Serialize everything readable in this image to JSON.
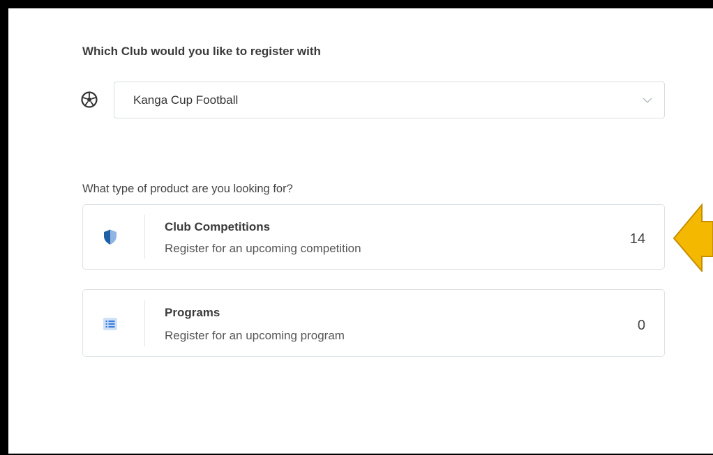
{
  "club": {
    "label": "Which Club would you like to register with",
    "selected": "Kanga Cup Football"
  },
  "products": {
    "label": "What type of product are you looking for?",
    "items": [
      {
        "title": "Club Competitions",
        "subtitle": "Register for an upcoming competition",
        "count": "14",
        "icon": "shield-icon"
      },
      {
        "title": "Programs",
        "subtitle": "Register for an upcoming program",
        "count": "0",
        "icon": "list-icon"
      }
    ]
  },
  "colors": {
    "shield_dark": "#1f5fa8",
    "shield_light": "#8fb6e3",
    "list_icon": "#3b7dd8",
    "highlight_arrow": "#f5b800"
  }
}
